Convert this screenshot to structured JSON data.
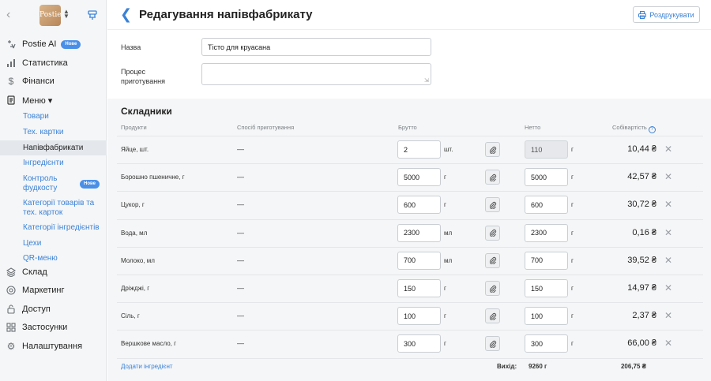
{
  "sidebar": {
    "logo_text": "Postie",
    "items": [
      {
        "label": "Postie AI",
        "badge": "Нове",
        "icon": "sparkle-icon"
      },
      {
        "label": "Статистика",
        "icon": "chart-icon"
      },
      {
        "label": "Фінанси",
        "icon": "dollar-icon"
      },
      {
        "label": "Меню ▾",
        "icon": "menu-book-icon"
      },
      {
        "label": "Склад",
        "icon": "layers-icon"
      },
      {
        "label": "Маркетинг",
        "icon": "target-icon"
      },
      {
        "label": "Доступ",
        "icon": "lock-icon"
      },
      {
        "label": "Застосунки",
        "icon": "apps-grid-icon"
      },
      {
        "label": "Налаштування",
        "icon": "gear-icon"
      }
    ],
    "menu_subitems": [
      {
        "label": "Товари"
      },
      {
        "label": "Тех. картки"
      },
      {
        "label": "Напівфабрикати"
      },
      {
        "label": "Інгредієнти"
      },
      {
        "label": "Контроль фудкосту",
        "badge": "Нове"
      },
      {
        "label": "Категорії товарів та тех. карток"
      },
      {
        "label": "Категорії інгредієнтів"
      },
      {
        "label": "Цехи"
      },
      {
        "label": "QR-меню"
      }
    ]
  },
  "header": {
    "title": "Редагування напівфабрикату",
    "print_label": "Роздрукувати"
  },
  "form": {
    "name_label": "Назва",
    "name_value": "Тісто для круасана",
    "process_label": "Процес приготування",
    "process_value": ""
  },
  "ingredients": {
    "title": "Складники",
    "columns": {
      "products": "Продукти",
      "method": "Спосіб приготування",
      "gross": "Брутто",
      "net": "Нетто",
      "cost": "Собівартість"
    },
    "rows": [
      {
        "product": "Яйце, шт.",
        "method": "—",
        "gross": "2",
        "gross_unit": "шт.",
        "net": "110",
        "net_unit": "г",
        "net_disabled": true,
        "cost": "10,44 ₴"
      },
      {
        "product": "Борошно пшеничне, г",
        "method": "—",
        "gross": "5000",
        "gross_unit": "г",
        "net": "5000",
        "net_unit": "г",
        "net_disabled": false,
        "cost": "42,57 ₴"
      },
      {
        "product": "Цукор, г",
        "method": "—",
        "gross": "600",
        "gross_unit": "г",
        "net": "600",
        "net_unit": "г",
        "net_disabled": false,
        "cost": "30,72 ₴"
      },
      {
        "product": "Вода, мл",
        "method": "—",
        "gross": "2300",
        "gross_unit": "мл",
        "net": "2300",
        "net_unit": "г",
        "net_disabled": false,
        "cost": "0,16 ₴"
      },
      {
        "product": "Молоко, мл",
        "method": "—",
        "gross": "700",
        "gross_unit": "мл",
        "net": "700",
        "net_unit": "г",
        "net_disabled": false,
        "cost": "39,52 ₴"
      },
      {
        "product": "Дріжджі, г",
        "method": "—",
        "gross": "150",
        "gross_unit": "г",
        "net": "150",
        "net_unit": "г",
        "net_disabled": false,
        "cost": "14,97 ₴"
      },
      {
        "product": "Сіль, г",
        "method": "—",
        "gross": "100",
        "gross_unit": "г",
        "net": "100",
        "net_unit": "г",
        "net_disabled": false,
        "cost": "2,37 ₴"
      },
      {
        "product": "Вершкове масло, г",
        "method": "—",
        "gross": "300",
        "gross_unit": "г",
        "net": "300",
        "net_unit": "г",
        "net_disabled": false,
        "cost": "66,00 ₴"
      }
    ],
    "add_label": "Додати інгредієнт",
    "yield_label": "Вихід:",
    "yield_value": "9260 г",
    "total_cost": "206,75 ₴"
  }
}
